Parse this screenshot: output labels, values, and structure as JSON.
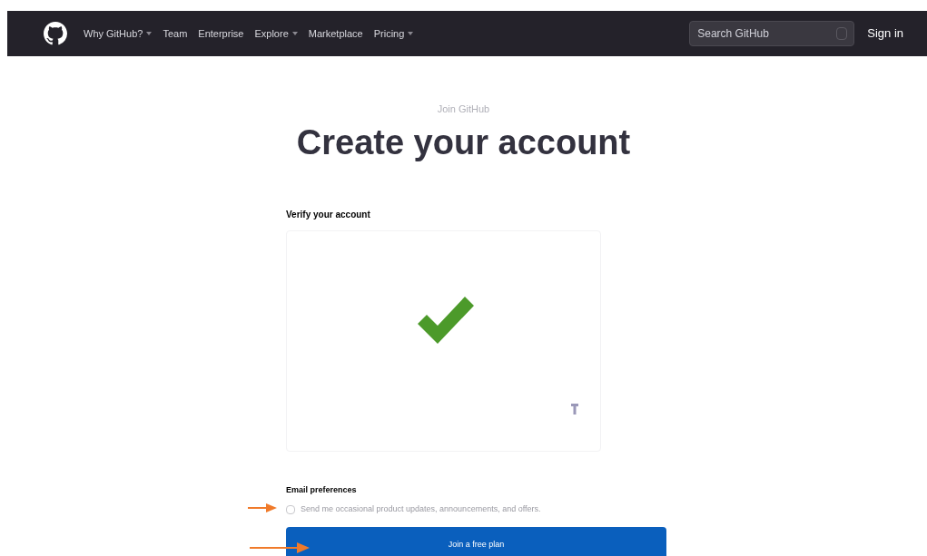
{
  "header": {
    "nav": [
      {
        "label": "Why GitHub?",
        "dropdown": true
      },
      {
        "label": "Team",
        "dropdown": false
      },
      {
        "label": "Enterprise",
        "dropdown": false
      },
      {
        "label": "Explore",
        "dropdown": true
      },
      {
        "label": "Marketplace",
        "dropdown": false
      },
      {
        "label": "Pricing",
        "dropdown": true
      }
    ],
    "search": {
      "placeholder": "Search GitHub"
    },
    "sign_in": "Sign in"
  },
  "eyebrow": "Join GitHub",
  "title": "Create your account",
  "verify": {
    "label": "Verify your account",
    "verified": true
  },
  "email_preferences": {
    "label": "Email preferences",
    "option": {
      "label": "Send me occasional product updates, announcements, and offers.",
      "checked": false
    }
  },
  "submit": "Join a free plan"
}
